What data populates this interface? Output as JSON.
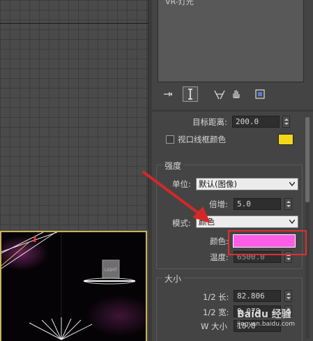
{
  "viewport_persp": {
    "box_label": "LIGHT"
  },
  "light_list": {
    "item_label": "VR-灯光"
  },
  "toolbar": {
    "pin_icon": "pin-stack-icon",
    "modifier_icon": "active-modifier-icon",
    "funnel_icon": "show-end-result-icon",
    "hand_icon": "make-unique-icon",
    "config_icon": "configure-modifier-sets-icon"
  },
  "target_group": {
    "target_distance_label": "目标距离:",
    "target_distance_value": "200.0",
    "wire_color_label": "视口线框颜色",
    "wire_color": "#f2d81a"
  },
  "intensity": {
    "title": "强度",
    "unit_label": "单位:",
    "unit_value": "默认(图像)",
    "multiplier_label": "倍增:",
    "multiplier_value": "5.0",
    "mode_label": "模式:",
    "mode_value": "颜色",
    "color_label": "颜色:",
    "color_value": "#ff5ce8",
    "temperature_label": "温度:",
    "temperature_value": "6500.0"
  },
  "size": {
    "title": "大小",
    "half_length_label": "1/2 长:",
    "half_length_value": "82.806",
    "half_width_label": "1/2 宽:",
    "half_width_value": "9.078",
    "w_size_label": "W 大小",
    "w_size_value": "10.0"
  },
  "annotation": {
    "arrow_color": "#d42828",
    "box_color": "#e03030"
  },
  "watermark": {
    "line1": "Baidu 经验",
    "line2": "jingyan.baidu.com"
  }
}
